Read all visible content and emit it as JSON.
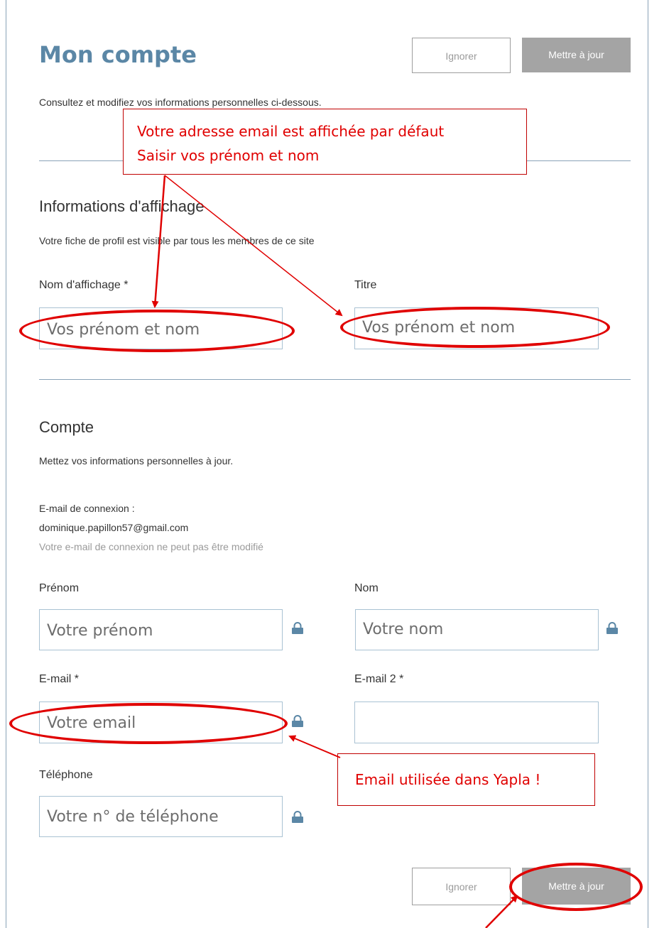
{
  "header": {
    "title": "Mon compte",
    "subtitle": "Consultez et modifiez vos informations personnelles ci-dessous.",
    "ignore_label": "Ignorer",
    "update_label": "Mettre à jour"
  },
  "display_section": {
    "title": "Informations d'affichage",
    "description": "Votre fiche de profil est visible par tous les membres de ce site",
    "display_name_label": "Nom d'affichage *",
    "display_name_value": "Vos prénom et nom",
    "title_label": "Titre",
    "title_value": "Vos prénom et nom"
  },
  "account_section": {
    "title": "Compte",
    "description": "Mettez vos informations personnelles à jour.",
    "login_email_label": "E-mail de connexion :",
    "login_email_value": "dominique.papillon57@gmail.com",
    "login_email_note": "Votre e-mail de connexion ne peut pas être modifié",
    "firstname_label": "Prénom",
    "firstname_value": "Votre prénom",
    "lastname_label": "Nom",
    "lastname_value": "Votre nom",
    "email_label": "E-mail *",
    "email_value": "Votre email",
    "email2_label": "E-mail 2 *",
    "email2_value": "",
    "phone_label": "Téléphone",
    "phone_value": "Votre n° de téléphone"
  },
  "footer": {
    "ignore_label": "Ignorer",
    "update_label": "Mettre à jour"
  },
  "annotations": {
    "callout_top_line1": "Votre adresse email est affichée par défaut",
    "callout_top_line2": "Saisir vos prénom et nom",
    "callout_email": "Email utilisée dans Yapla !"
  },
  "colors": {
    "title": "#5b87a6",
    "annotation": "#e00000",
    "field_border": "#a9c2d3",
    "button_fill": "#a4a4a4"
  },
  "icons": [
    "lock-icon"
  ]
}
